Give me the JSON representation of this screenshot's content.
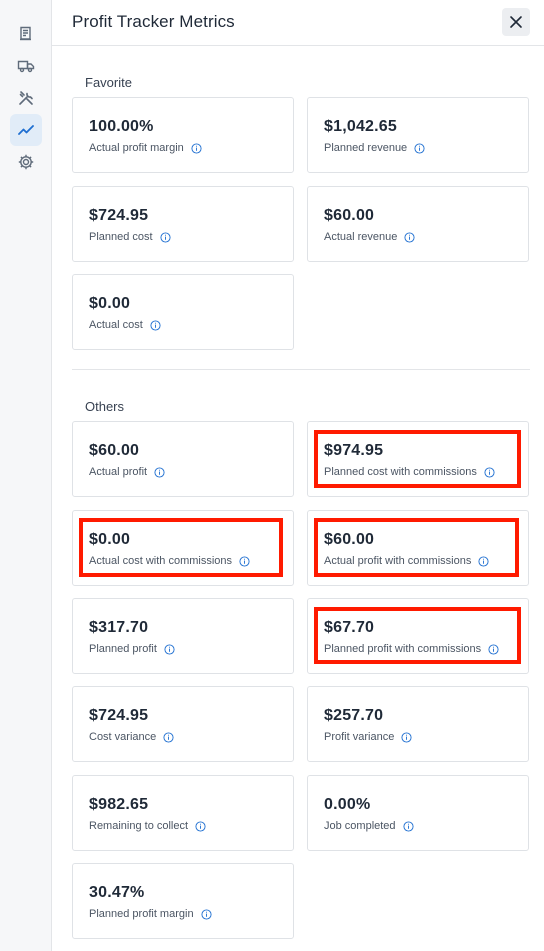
{
  "header": {
    "title": "Profit Tracker Metrics"
  },
  "rail": {
    "items": [
      {
        "icon": "receipt-icon",
        "active": false
      },
      {
        "icon": "truck-icon",
        "active": false
      },
      {
        "icon": "tools-icon",
        "active": false
      },
      {
        "icon": "trend-icon",
        "active": true
      },
      {
        "icon": "gear-icon",
        "active": false
      }
    ]
  },
  "sections": {
    "favorite": {
      "title": "Favorite",
      "cards": [
        {
          "value": "100.00%",
          "label": "Actual profit margin"
        },
        {
          "value": "$1,042.65",
          "label": "Planned revenue"
        },
        {
          "value": "$724.95",
          "label": "Planned cost"
        },
        {
          "value": "$60.00",
          "label": "Actual revenue"
        },
        {
          "value": "$0.00",
          "label": "Actual cost"
        }
      ]
    },
    "others": {
      "title": "Others",
      "cards": [
        {
          "value": "$60.00",
          "label": "Actual profit"
        },
        {
          "value": "$974.95",
          "label": "Planned cost with commissions",
          "highlighted": true
        },
        {
          "value": "$0.00",
          "label": "Actual cost with commissions",
          "highlighted": true
        },
        {
          "value": "$60.00",
          "label": "Actual profit with commissions",
          "highlighted": true
        },
        {
          "value": "$317.70",
          "label": "Planned profit"
        },
        {
          "value": "$67.70",
          "label": "Planned profit with commissions",
          "highlighted": true
        },
        {
          "value": "$724.95",
          "label": "Cost variance"
        },
        {
          "value": "$257.70",
          "label": "Profit variance"
        },
        {
          "value": "$982.65",
          "label": "Remaining to collect"
        },
        {
          "value": "0.00%",
          "label": "Job completed"
        },
        {
          "value": "30.47%",
          "label": "Planned profit margin"
        }
      ]
    }
  },
  "colors": {
    "accent": "#1f6fd1",
    "highlight": "#ff1a00",
    "border": "#dfe2e6"
  }
}
